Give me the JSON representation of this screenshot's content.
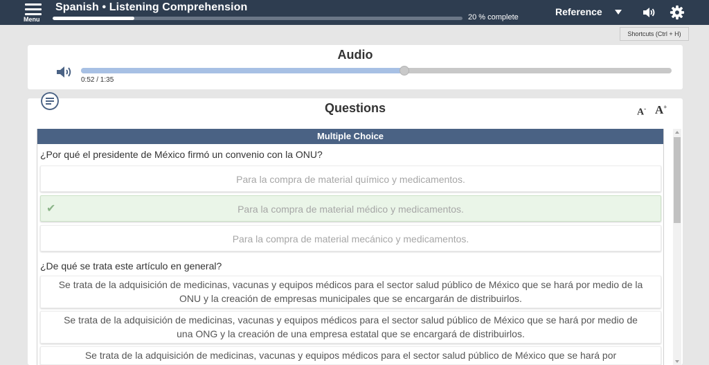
{
  "topbar": {
    "menu_label": "Menu",
    "title": "Spanish • Listening Comprehension",
    "progress_percent": 20,
    "progress_text": "20 % complete",
    "reference_label": "Reference",
    "icons": [
      "menu-icon",
      "caret-down-icon",
      "volume-icon",
      "gear-icon"
    ]
  },
  "shortcuts_label": "Shortcuts (Ctrl + H)",
  "audio": {
    "title": "Audio",
    "time_label": "0:52 / 1:35",
    "position_fraction": 0.547,
    "icon": "speaker-icon"
  },
  "questions": {
    "title": "Questions",
    "font_decrease": "A",
    "font_increase": "A",
    "section_label": "Multiple Choice",
    "items": [
      {
        "prompt": "¿Por qué el presidente de México firmó un convenio con la ONU?",
        "options": [
          {
            "text": "Para la compra de material químico y medicamentos.",
            "correct": false
          },
          {
            "text": "Para la compra de material médico y medicamentos.",
            "correct": true
          },
          {
            "text": "Para la compra de material mecánico y medicamentos.",
            "correct": false
          }
        ]
      },
      {
        "prompt": "¿De qué se trata este artículo en general?",
        "options": [
          {
            "text": "Se trata de la adquisición de medicinas, vacunas y equipos médicos para el sector salud público de México que se hará por medio de la ONU y la creación de empresas municipales que se encargarán de distribuirlos."
          },
          {
            "text": "Se trata de la adquisición de medicinas, vacunas y equipos médicos para el sector salud público de México que se hará por medio de una ONG y la creación de una empresa estatal que se encargará de distribuirlos."
          },
          {
            "text": "Se trata de la adquisición de medicinas, vacunas y equipos médicos para el sector salud público de México que se hará por"
          }
        ]
      }
    ]
  },
  "colors": {
    "topbar": "#2e3d50",
    "section_header": "#4a6284",
    "audio_fill": "#a7c0e4",
    "correct_bg": "#eaf5e8"
  }
}
